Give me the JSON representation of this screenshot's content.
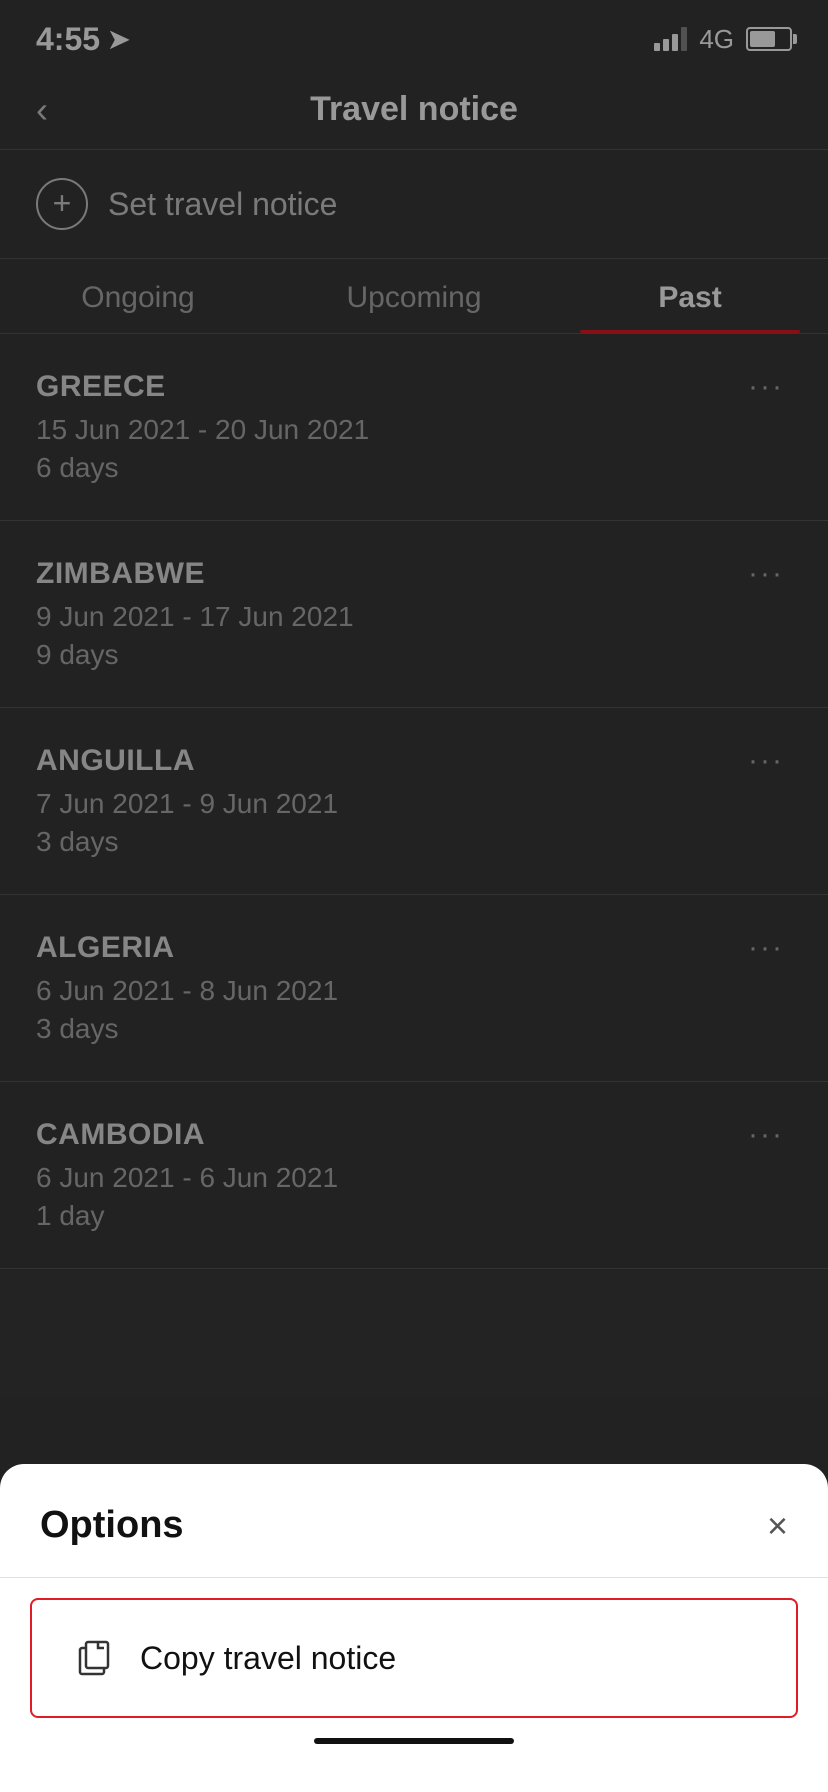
{
  "statusBar": {
    "time": "4:55",
    "network": "4G"
  },
  "header": {
    "back_label": "‹",
    "title": "Travel notice"
  },
  "setNotice": {
    "label": "Set travel notice"
  },
  "tabs": [
    {
      "id": "ongoing",
      "label": "Ongoing",
      "active": false
    },
    {
      "id": "upcoming",
      "label": "Upcoming",
      "active": false
    },
    {
      "id": "past",
      "label": "Past",
      "active": true
    }
  ],
  "travelItems": [
    {
      "country": "GREECE",
      "dates": "15 Jun 2021 - 20 Jun 2021",
      "duration": "6 days"
    },
    {
      "country": "ZIMBABWE",
      "dates": "9 Jun 2021 - 17 Jun 2021",
      "duration": "9 days"
    },
    {
      "country": "ANGUILLA",
      "dates": "7 Jun 2021 - 9 Jun 2021",
      "duration": "3 days"
    },
    {
      "country": "ALGERIA",
      "dates": "6 Jun 2021 - 8 Jun 2021",
      "duration": "3 days"
    },
    {
      "country": "CAMBODIA",
      "dates": "6 Jun 2021 - 6 Jun 2021",
      "duration": "1 day"
    }
  ],
  "bottomSheet": {
    "title": "Options",
    "close_label": "×",
    "option": {
      "label": "Copy travel notice",
      "icon": "copy-icon"
    }
  }
}
